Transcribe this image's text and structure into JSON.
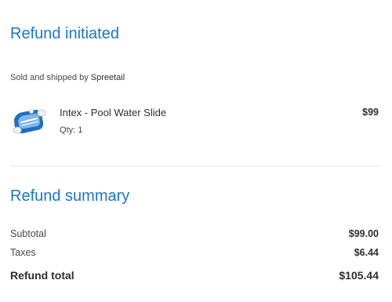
{
  "refund": {
    "title": "Refund initiated",
    "sold_by_prefix": "Sold and shipped by",
    "seller_name": "Spreetail"
  },
  "item": {
    "name": "Intex - Pool Water Slide",
    "qty": "Qty: 1",
    "price": "$99",
    "image_icon": "pool-water-slide-product-image"
  },
  "summary": {
    "title": "Refund summary",
    "rows": [
      {
        "label": "Subtotal",
        "value": "$99.00"
      },
      {
        "label": "Taxes",
        "value": "$6.44"
      }
    ],
    "total_label": "Refund total",
    "total_value": "$105.44"
  },
  "colors": {
    "heading_blue": "#1a75cf",
    "text_dark": "#2e2f32",
    "text_muted": "#46474a",
    "divider": "#e6e7e8",
    "slide_blue": "#1e6fc1"
  }
}
